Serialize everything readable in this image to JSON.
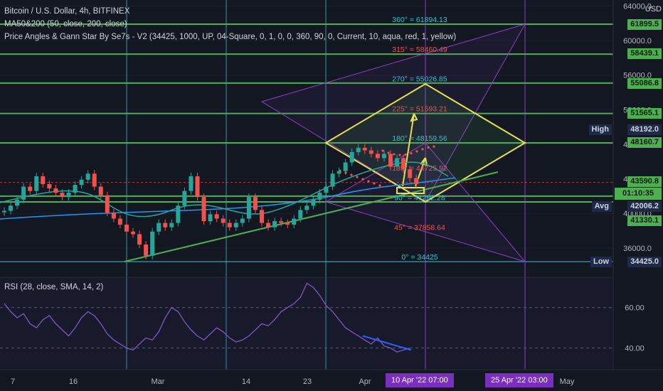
{
  "header": {
    "symbol_line": "Bitcoin / U.S. Dollar, 4h, BITFINEX",
    "ma_line": "MA50&200 (50, close, 200, close)",
    "gann_line": "Price Angles & Gann Star By Se7s - V2 (34425, 1000, UP, 04-Square, 0, 1, 0, 0, 360, 90, 0, Current, 10, aqua, red, 1, yellow)"
  },
  "rsi_label": "RSI (28, close, SMA, 14, 2)",
  "currency": "USD",
  "colors": {
    "background": "#131722",
    "green": "#4caf50",
    "purple": "#8e3fc7",
    "yellow": "#e8e04a",
    "aqua": "#2ec4d6",
    "red": "#ef5350"
  },
  "chart_data": {
    "type": "line",
    "title": "Bitcoin / U.S. Dollar, 4h, BITFINEX",
    "ylim": [
      33000,
      65000
    ],
    "y_ticks": [
      36000,
      40000,
      44000,
      48000,
      52000,
      56000,
      60000,
      64000
    ],
    "x_ticks": [
      "7",
      "16",
      "Mar",
      "14",
      "23",
      "Apr",
      "May"
    ],
    "price_path": [
      [
        0,
        40300
      ],
      [
        1,
        40900
      ],
      [
        2,
        41600
      ],
      [
        3,
        43100
      ],
      [
        4,
        42600
      ],
      [
        5,
        44300
      ],
      [
        6,
        43400
      ],
      [
        7,
        42900
      ],
      [
        8,
        42400
      ],
      [
        9,
        41900
      ],
      [
        10,
        42400
      ],
      [
        11,
        43300
      ],
      [
        12,
        43900
      ],
      [
        13,
        44600
      ],
      [
        14,
        43100
      ],
      [
        15,
        42100
      ],
      [
        16,
        40100
      ],
      [
        17,
        39400
      ],
      [
        18,
        38700
      ],
      [
        19,
        37900
      ],
      [
        20,
        37600
      ],
      [
        21,
        36400
      ],
      [
        22,
        35100
      ],
      [
        23,
        37900
      ],
      [
        24,
        38900
      ],
      [
        25,
        38400
      ],
      [
        26,
        38900
      ],
      [
        27,
        40900
      ],
      [
        28,
        42600
      ],
      [
        29,
        44300
      ],
      [
        30,
        41900
      ],
      [
        31,
        39100
      ],
      [
        32,
        39900
      ],
      [
        33,
        39400
      ],
      [
        34,
        38900
      ],
      [
        35,
        38400
      ],
      [
        36,
        38900
      ],
      [
        37,
        39400
      ],
      [
        38,
        41900
      ],
      [
        39,
        40400
      ],
      [
        40,
        38900
      ],
      [
        41,
        38400
      ],
      [
        42,
        39100
      ],
      [
        43,
        38900
      ],
      [
        44,
        38700
      ],
      [
        45,
        39400
      ],
      [
        46,
        40400
      ],
      [
        47,
        40900
      ],
      [
        48,
        41600
      ],
      [
        49,
        42400
      ],
      [
        50,
        43100
      ],
      [
        51,
        44600
      ],
      [
        52,
        44900
      ],
      [
        53,
        45900
      ],
      [
        54,
        47100
      ],
      [
        55,
        47600
      ],
      [
        56,
        47300
      ],
      [
        57,
        46900
      ],
      [
        58,
        46400
      ],
      [
        59,
        46900
      ],
      [
        60,
        45400
      ],
      [
        61,
        46400
      ],
      [
        62,
        45100
      ],
      [
        63,
        44100
      ],
      [
        64,
        43400
      ]
    ],
    "horizontal_levels": [
      {
        "value": 61899.5,
        "label": "61899.5"
      },
      {
        "value": 58439.1,
        "label": "58439.1"
      },
      {
        "value": 55086.8,
        "label": "55086.8"
      },
      {
        "value": 51565.1,
        "label": "51565.1"
      },
      {
        "value": 48160.7,
        "label": "48160.7"
      },
      {
        "value": 42006.2,
        "label": "42006.2",
        "name": "Avg"
      },
      {
        "value": 41330.1,
        "label": "41330.1"
      }
    ],
    "gann_angles": [
      {
        "label": "360° = 61894.13",
        "value": 61894.13,
        "color": "aqua"
      },
      {
        "label": "315° = 58460.49",
        "value": 58460.49,
        "color": "red"
      },
      {
        "label": "270° = 55026.85",
        "value": 55026.85,
        "color": "aqua"
      },
      {
        "label": "225° = 51593.21",
        "value": 51593.21,
        "color": "red"
      },
      {
        "label": "180° = 48159.56",
        "value": 48159.56,
        "color": "aqua"
      },
      {
        "label": "135° = 44725.92",
        "value": 44725.92,
        "color": "red"
      },
      {
        "label": "90° = 41292.28",
        "value": 41292.28,
        "color": "aqua"
      },
      {
        "label": "45° = 37858.64",
        "value": 37858.64,
        "color": "red"
      },
      {
        "label": "0° = 34425",
        "value": 34425,
        "color": "aqua"
      }
    ],
    "high": {
      "name": "High",
      "value": "48192.0"
    },
    "low": {
      "name": "Low",
      "value": "34425.0"
    },
    "current_price": {
      "value": "43590.8",
      "countdown": "01:10:35"
    },
    "rsi": {
      "ylim": [
        30,
        75
      ],
      "y_ticks": [
        40,
        60
      ],
      "values": [
        62,
        58,
        55,
        57,
        52,
        50,
        54,
        56,
        52,
        49,
        46,
        50,
        55,
        58,
        56,
        52,
        47,
        44,
        42,
        40,
        39,
        42,
        45,
        44,
        48,
        55,
        60,
        58,
        53,
        49,
        46,
        44,
        47,
        50,
        48,
        45,
        43,
        44,
        46,
        49,
        52,
        51,
        54,
        58,
        60,
        62,
        65,
        72,
        70,
        66,
        61,
        58,
        54,
        50,
        48,
        46,
        44,
        42,
        45,
        41,
        40,
        38,
        39,
        40
      ]
    },
    "date_markers": [
      "10 Apr '22   07:00",
      "25 Apr '22   03:00"
    ]
  }
}
